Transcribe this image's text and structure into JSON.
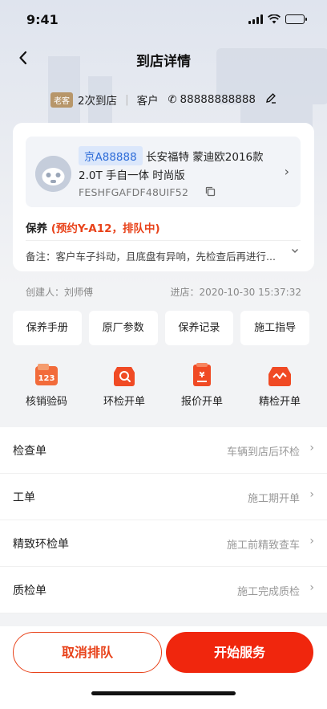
{
  "status_bar": {
    "time": "9:41"
  },
  "nav": {
    "title": "到店详情"
  },
  "customer": {
    "badge": "老客",
    "visits": "2次到店",
    "type": "客户",
    "phone": "88888888888"
  },
  "vehicle": {
    "plate": "京A88888",
    "model_line1": "长安福特 蒙迪欧2016款",
    "model_line2": "2.0T 手自一体 时尚版",
    "vin": "FESHFGAFDF48UIF52"
  },
  "service": {
    "type": "保养",
    "status": "(预约Y-A12，排队中)",
    "note": "备注：客户车子抖动，且底盘有异响，先检查后再进行..."
  },
  "meta": {
    "creator": "创建人：刘师傅",
    "entry_time": "进店：2020-10-30 15:37:32"
  },
  "quick_actions": [
    "保养手册",
    "原厂参数",
    "保养记录",
    "施工指导"
  ],
  "tools": [
    {
      "label": "核销验码",
      "icon": "coupon-code-icon"
    },
    {
      "label": "环检开单",
      "icon": "inspection-search-icon"
    },
    {
      "label": "报价开单",
      "icon": "quote-price-icon"
    },
    {
      "label": "精检开单",
      "icon": "fine-inspection-car-icon"
    }
  ],
  "rows": [
    {
      "label": "检查单",
      "value": "车辆到店后环检"
    },
    {
      "label": "工单",
      "value": "施工期开单"
    },
    {
      "label": "精致环检单",
      "value": "施工前精致查车"
    },
    {
      "label": "质检单",
      "value": "施工完成质检"
    }
  ],
  "footer": {
    "cancel": "取消排队",
    "start": "开始服务"
  },
  "colors": {
    "accent": "#f0260d",
    "accent_text": "#e8421a",
    "plate_bg": "#dbe7fb",
    "plate_text": "#2c6bd8",
    "old_badge": "#b7966a"
  }
}
